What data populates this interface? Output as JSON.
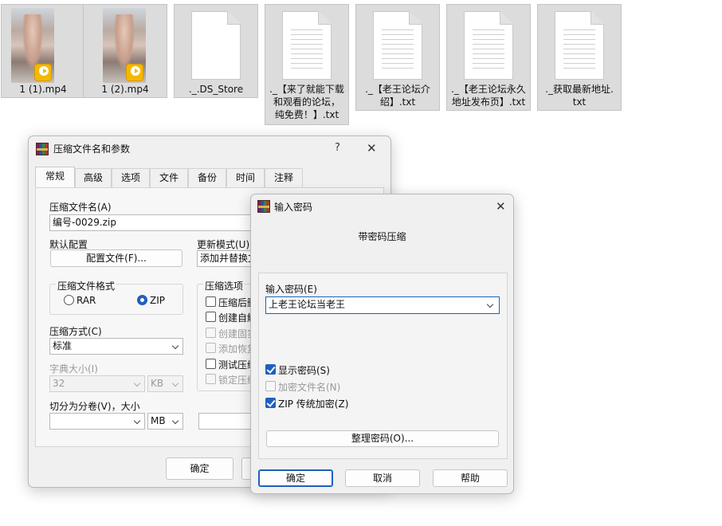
{
  "files": [
    {
      "name": "1 (1).mp4",
      "type": "video"
    },
    {
      "name": "1 (2).mp4",
      "type": "video"
    },
    {
      "name": "._.DS_Store",
      "type": "blank"
    },
    {
      "name": "._【来了就能下载\n和观看的论坛，\n纯免费！】.txt",
      "type": "text"
    },
    {
      "name": "._【老王论坛介\n绍】.txt",
      "type": "text"
    },
    {
      "name": "._【老王论坛永久\n地址发布页】.txt",
      "type": "text"
    },
    {
      "name": "._获取最新地址.\ntxt",
      "type": "text"
    }
  ],
  "archive_dialog": {
    "title": "压缩文件名和参数",
    "help": "?",
    "close": "✕",
    "tabs": [
      "常规",
      "高级",
      "选项",
      "文件",
      "备份",
      "时间",
      "注释"
    ],
    "archive_name_label": "压缩文件名(A)",
    "archive_name_value": "编号-0029.zip",
    "default_profile_label": "默认配置",
    "profiles_button": "配置文件(F)...",
    "update_mode_label": "更新模式(U)",
    "update_mode_value": "添加并替换文",
    "format_group_label": "压缩文件格式",
    "format_rar": "RAR",
    "format_zip": "ZIP",
    "method_label": "压缩方式(C)",
    "method_value": "标准",
    "dict_label": "字典大小(I)",
    "dict_value": "32",
    "dict_unit": "KB",
    "options_group_label": "压缩选项",
    "options": [
      {
        "label": "压缩后删",
        "enabled": true
      },
      {
        "label": "创建自解",
        "enabled": true
      },
      {
        "label": "创建固实",
        "enabled": false
      },
      {
        "label": "添加恢复",
        "enabled": false
      },
      {
        "label": "测试压缩",
        "enabled": true
      },
      {
        "label": "锁定压缩",
        "enabled": false
      }
    ],
    "split_label": "切分为分卷(V)，大小",
    "split_unit": "MB",
    "ok_button": "确定"
  },
  "password_dialog": {
    "title": "输入密码",
    "close": "✕",
    "heading": "带密码压缩",
    "enter_label": "输入密码(E)",
    "password_value": "上老王论坛当老王",
    "show_password": "显示密码(S)",
    "encrypt_names": "加密文件名(N)",
    "zip_legacy": "ZIP 传统加密(Z)",
    "organize_button": "整理密码(O)...",
    "ok_button": "确定",
    "cancel_button": "取消",
    "help_button": "帮助"
  },
  "colors": {
    "accent": "#1f5fbf",
    "dialog_bg": "#f0f0f0",
    "file_selected_bg": "#dcdcdc"
  }
}
